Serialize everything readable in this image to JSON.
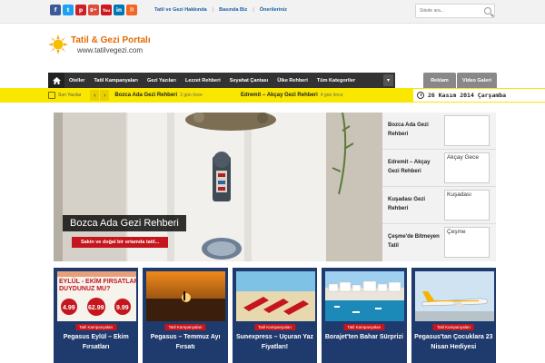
{
  "social": [
    {
      "name": "facebook-icon",
      "glyph": "f",
      "color": "#3b5998"
    },
    {
      "name": "twitter-icon",
      "glyph": "t",
      "color": "#1da1f2"
    },
    {
      "name": "pinterest-icon",
      "glyph": "p",
      "color": "#cb2027"
    },
    {
      "name": "googleplus-icon",
      "glyph": "g+",
      "color": "#dd4b39"
    },
    {
      "name": "youtube-icon",
      "glyph": "You",
      "color": "#cc181e"
    },
    {
      "name": "linkedin-icon",
      "glyph": "in",
      "color": "#0077b5"
    },
    {
      "name": "rss-icon",
      "glyph": "))",
      "color": "#f26522"
    }
  ],
  "toplinks": [
    "Tatil ve Gezi Hakkında",
    "Basında Biz",
    "Önerileriniz"
  ],
  "search": {
    "placeholder": "Sitede ara..."
  },
  "logo": {
    "title": "Tatil & Gezi Portalı",
    "url": "www.tatilvegezi.com"
  },
  "nav": {
    "items": [
      "Oteller",
      "Tatil Kampanyaları",
      "Gezi Yazıları",
      "Lezzet Rehberi",
      "Seyahat Çantası",
      "Ülke Rehberi",
      "Tüm Kategoriler"
    ],
    "right": [
      "Reklam",
      "Video Galeri"
    ]
  },
  "ticker": {
    "label": "Son Yazılar",
    "items": [
      {
        "title": "Bozca Ada Gezi Rehberi",
        "time": "2 gün önce"
      },
      {
        "title": "Edremit – Akçay Gezi Rehberi",
        "time": "4 gün önce"
      }
    ],
    "date": "26 Kasım 2014 Çarşamba"
  },
  "feature": {
    "title": "Bozca Ada Gezi Rehberi",
    "subtitle": "Sakin ve doğal bir ortamda tatil..."
  },
  "side": [
    {
      "title": "Bozca Ada Gezi Rehberi",
      "thumb": ""
    },
    {
      "title": "Edremit – Akçay Gezi Rehberi",
      "thumb": "Akçay Gece"
    },
    {
      "title": "Kuşadası Gezi Rehberi",
      "thumb": "Kuşadası"
    },
    {
      "title": "Çeşme'de Bitmeyen Tatil",
      "thumb": "Çeşme"
    }
  ],
  "cards": [
    {
      "tag": "Tatil Kampanyaları",
      "title": "Pegasus Eylül – Ekim Fırsatları",
      "ad": {
        "l1": "EYLÜL - EKİM FIRSATLARINI",
        "l2": "DUYDUNUZ MU?",
        "p1": "4.99",
        "p2": "62.99",
        "p3": "9.99"
      }
    },
    {
      "tag": "Tatil Kampanyaları",
      "title": "Pegasus – Temmuz Ayı Fırsatı"
    },
    {
      "tag": "Tatil Kampanyaları",
      "title": "Sunexpress – Uçuran Yaz Fiyatları!"
    },
    {
      "tag": "Tatil Kampanyaları",
      "title": "Borajet'ten Bahar Sürprizi"
    },
    {
      "tag": "Tatil Kampanyaları",
      "title": "Pegasus'tan Çocuklara 23 Nisan Hediyesi"
    }
  ],
  "colors": {
    "accent": "#c4161c",
    "ticker": "#f9e700",
    "nav": "#333333",
    "cards": "#1f3a6d",
    "logo": "#e36b00"
  }
}
